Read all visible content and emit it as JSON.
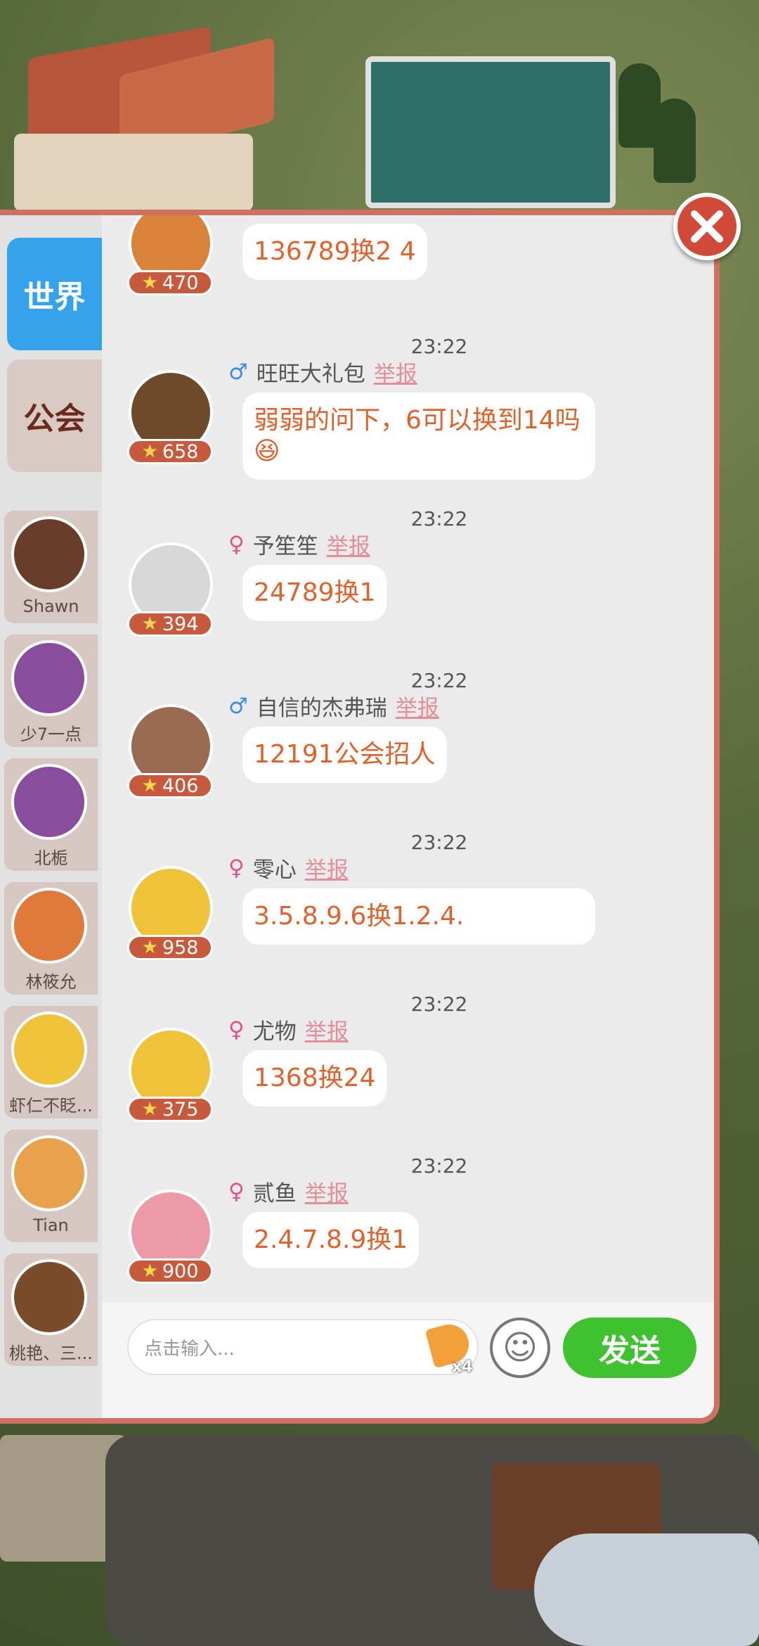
{
  "tabs": [
    {
      "label": "世界",
      "active": true
    },
    {
      "label": "公会",
      "active": false
    }
  ],
  "friends": [
    {
      "name": "Shawn",
      "avatar_color": "#6a3d2a"
    },
    {
      "name": "少7一点",
      "avatar_color": "#8a4c9c"
    },
    {
      "name": "北栀",
      "avatar_color": "#8a4c9c"
    },
    {
      "name": "林筱允",
      "avatar_color": "#e07a3a"
    },
    {
      "name": "虾仁不眨...",
      "avatar_color": "#f0c23a"
    },
    {
      "name": "Tian",
      "avatar_color": "#e9a24c"
    },
    {
      "name": "桃艳、三...",
      "avatar_color": "#7a4c2a"
    }
  ],
  "messages": [
    {
      "time": "",
      "gender": "",
      "name": "",
      "report": "",
      "level": "470",
      "text": "136789换2 4",
      "avatar_color": "#d8823a"
    },
    {
      "time": "23:22",
      "gender": "♂",
      "name": "旺旺大礼包",
      "report": "举报",
      "level": "658",
      "text": "弱弱的问下，6可以换到14吗😆",
      "avatar_color": "#6d4a2a"
    },
    {
      "time": "23:22",
      "gender": "♀",
      "name": "予笙笙",
      "report": "举报",
      "level": "394",
      "text": "24789换1",
      "avatar_color": "#d8d8d8"
    },
    {
      "time": "23:22",
      "gender": "♂",
      "name": "自信的杰弗瑞",
      "report": "举报",
      "level": "406",
      "text": "12191公会招人",
      "avatar_color": "#9a6a52"
    },
    {
      "time": "23:22",
      "gender": "♀",
      "name": "零心",
      "report": "举报",
      "level": "958",
      "text": "3.5.8.9.6换1.2.4.",
      "avatar_color": "#f0c23a"
    },
    {
      "time": "23:22",
      "gender": "♀",
      "name": "尤物",
      "report": "举报",
      "level": "375",
      "text": "1368换24",
      "avatar_color": "#f0c23a"
    },
    {
      "time": "23:22",
      "gender": "♀",
      "name": "贰鱼",
      "report": "举报",
      "level": "900",
      "text": "2.4.7.8.9换1",
      "avatar_color": "#ec9aa8"
    }
  ],
  "input": {
    "placeholder": "点击输入...",
    "horn_count": "x4"
  },
  "send_label": "发送",
  "colors": {
    "world_tab": "#35a3ec",
    "send_button": "#3fc130",
    "panel_border": "#cf7060",
    "message_text": "#e0622a"
  }
}
